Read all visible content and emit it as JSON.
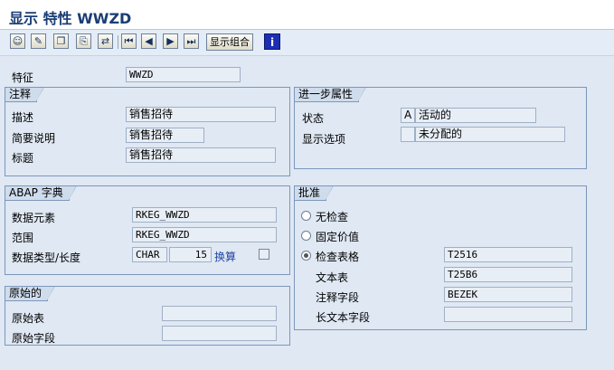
{
  "title": "显示 特性 WWZD",
  "toolbar": {
    "display_combo_label": "显示组合",
    "info_label": "i"
  },
  "characteristic": {
    "label": "特征",
    "value": "WWZD"
  },
  "comment_group": {
    "title": "注释",
    "rows": [
      {
        "label": "描述",
        "value": "销售招待"
      },
      {
        "label": "简要说明",
        "value": "销售招待"
      },
      {
        "label": "标题",
        "value": "销售招待"
      }
    ]
  },
  "further_group": {
    "title": "进一步属性",
    "status_label": "状态",
    "status_code": "A",
    "status_text": "活动的",
    "display_label": "显示选项",
    "display_code": "",
    "display_text": "未分配的"
  },
  "abap_group": {
    "title": "ABAP 字典",
    "data_element_label": "数据元素",
    "data_element_value": "RKEG_WWZD",
    "domain_label": "范围",
    "domain_value": "RKEG_WWZD",
    "type_label": "数据类型/长度",
    "type_value": "CHAR",
    "length_value": "15",
    "conversion_label": "换算"
  },
  "origin_group": {
    "title": "原始的",
    "table_label": "原始表",
    "table_value": "",
    "field_label": "原始字段",
    "field_value": ""
  },
  "check_group": {
    "title": "批准",
    "options": [
      {
        "label": "无检查",
        "selected": false
      },
      {
        "label": "固定价值",
        "selected": false
      },
      {
        "label": "检查表格",
        "selected": true,
        "value": "T2516"
      }
    ],
    "text_table_label": "文本表",
    "text_table_value": "T25B6",
    "comment_field_label": "注释字段",
    "comment_field_value": "BEZEK",
    "long_text_label": "长文本字段",
    "long_text_value": ""
  }
}
